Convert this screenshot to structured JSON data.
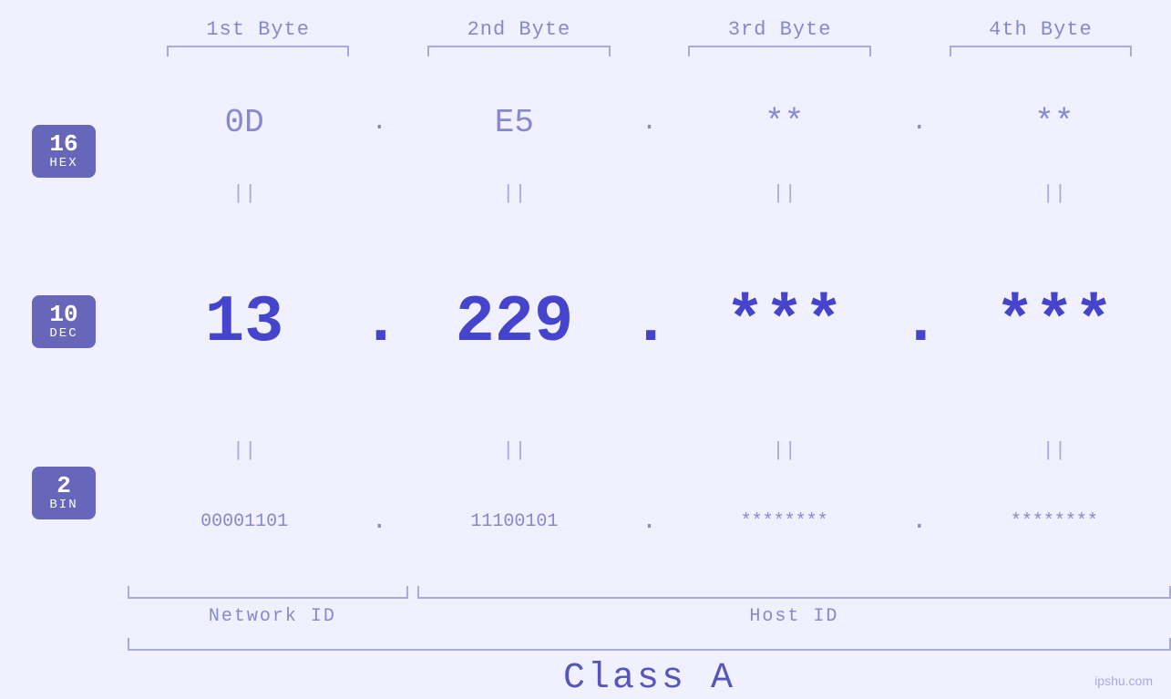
{
  "header": {
    "byte1_label": "1st Byte",
    "byte2_label": "2nd Byte",
    "byte3_label": "3rd Byte",
    "byte4_label": "4th Byte"
  },
  "bases": [
    {
      "num": "16",
      "name": "HEX"
    },
    {
      "num": "10",
      "name": "DEC"
    },
    {
      "num": "2",
      "name": "BIN"
    }
  ],
  "hex_row": {
    "byte1": "0D",
    "byte2": "E5",
    "byte3": "**",
    "byte4": "**",
    "dot": "."
  },
  "dec_row": {
    "byte1": "13",
    "byte2": "229",
    "byte3": "***",
    "byte4": "***",
    "dot": "."
  },
  "bin_row": {
    "byte1": "00001101",
    "byte2": "11100101",
    "byte3": "********",
    "byte4": "********",
    "dot": "."
  },
  "labels": {
    "network_id": "Network ID",
    "host_id": "Host ID",
    "class": "Class A"
  },
  "watermark": "ipshu.com",
  "equals": "||"
}
